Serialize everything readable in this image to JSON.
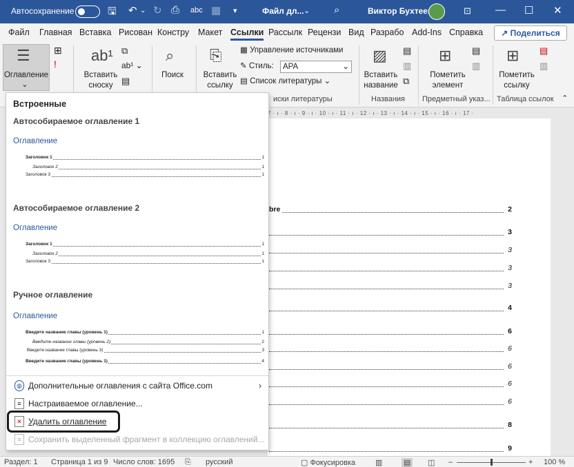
{
  "titlebar": {
    "autosave_label": "Автосохранение",
    "filename": "Файл дл...",
    "user_name": "Виктор Бухтеев",
    "bg_color": "#2b579a"
  },
  "tabs": [
    {
      "label": "Файл"
    },
    {
      "label": "Главная"
    },
    {
      "label": "Вставка"
    },
    {
      "label": "Рисован"
    },
    {
      "label": "Констру"
    },
    {
      "label": "Макет"
    },
    {
      "label": "Ссылки"
    },
    {
      "label": "Рассылк"
    },
    {
      "label": "Рецензи"
    },
    {
      "label": "Вид"
    },
    {
      "label": "Разрабо"
    },
    {
      "label": "Add-Ins"
    },
    {
      "label": "Справка"
    }
  ],
  "share_label": "Поделиться",
  "ribbon": {
    "toc_button": "Оглавление",
    "insert_footnote": [
      "Вставить",
      "сноску"
    ],
    "search": "Поиск",
    "insert_citation": [
      "Вставить",
      "ссылку"
    ],
    "manage_sources": "Управление источниками",
    "style_label": "Стиль:",
    "style_value": "APA",
    "bibliography": "Список литературы",
    "insert_caption": [
      "Вставить",
      "название"
    ],
    "mark_entry": [
      "Пометить",
      "элемент"
    ],
    "mark_citation": [
      "Пометить",
      "ссылку"
    ],
    "groups": {
      "citations": "иски литературы",
      "captions": "Названия",
      "index": "Предметный указ...",
      "toa": "Таблица ссылок"
    }
  },
  "ruler_text": "7 · ı · 8 · ı · 9 · ı · 10 · ı · 11 · ı · 12 · ı · 13 · ı · 14 · ı · 15 · ı · 16 · ı · 17 ·",
  "document_toc": [
    {
      "text": "bre",
      "page": "2",
      "style": "b"
    },
    {
      "text": "",
      "page": "3",
      "style": "b"
    },
    {
      "text": "",
      "page": "3",
      "style": "i"
    },
    {
      "text": "",
      "page": "3",
      "style": "i"
    },
    {
      "text": "",
      "page": "3",
      "style": "i"
    },
    {
      "text": "",
      "page": "4",
      "style": "b"
    },
    {
      "text": "",
      "page": "6",
      "style": "b"
    },
    {
      "text": "",
      "page": "6",
      "style": "i"
    },
    {
      "text": "",
      "page": "6",
      "style": "i"
    },
    {
      "text": "",
      "page": "6",
      "style": "i"
    },
    {
      "text": "",
      "page": "6",
      "style": "i"
    },
    {
      "text": "",
      "page": "8",
      "style": "b"
    },
    {
      "text": "",
      "page": "9",
      "style": "b"
    }
  ],
  "dropdown": {
    "header": "Встроенные",
    "sections": [
      {
        "title": "Автособираемое оглавление 1",
        "heading": "Оглавление",
        "lines": [
          {
            "text": "Заголовок 1",
            "page": "1",
            "style": "b"
          },
          {
            "text": "Заголовок 2",
            "page": "1",
            "style": "i"
          },
          {
            "text": "Заголовок 3",
            "page": "1",
            "style": "n"
          }
        ]
      },
      {
        "title": "Автособираемое оглавление 2",
        "heading": "Оглавление",
        "lines": [
          {
            "text": "Заголовок 1",
            "page": "1",
            "style": "b"
          },
          {
            "text": "Заголовок 2",
            "page": "1",
            "style": "i"
          },
          {
            "text": "Заголовок 3",
            "page": "1",
            "style": "n"
          }
        ]
      },
      {
        "title": "Ручное оглавление",
        "heading": "Оглавление",
        "lines": [
          {
            "text": "Введите название главы (уровень 1)",
            "page": "1",
            "style": "b"
          },
          {
            "text": "Введите название главы (уровень 2)",
            "page": "2",
            "style": "i"
          },
          {
            "text": "Введите название главы (уровень 3)",
            "page": "3",
            "style": "n"
          },
          {
            "text": "Введите название главы (уровень 1)",
            "page": "4",
            "style": "b"
          }
        ]
      }
    ],
    "menu": [
      {
        "label": "Дополнительные оглавления с сайта Office.com",
        "enabled": true
      },
      {
        "label": "Настраиваемое оглавление...",
        "enabled": true
      },
      {
        "label": "Удалить оглавление",
        "enabled": true
      },
      {
        "label": "Сохранить выделенный фрагмент в коллекцию оглавлений...",
        "enabled": false
      }
    ]
  },
  "status": {
    "section": "Раздел: 1",
    "page": "Страница 1 из 9",
    "words": "Число слов: 1695",
    "language": "русский",
    "focus": "Фокусировка",
    "zoom": "100 %"
  }
}
